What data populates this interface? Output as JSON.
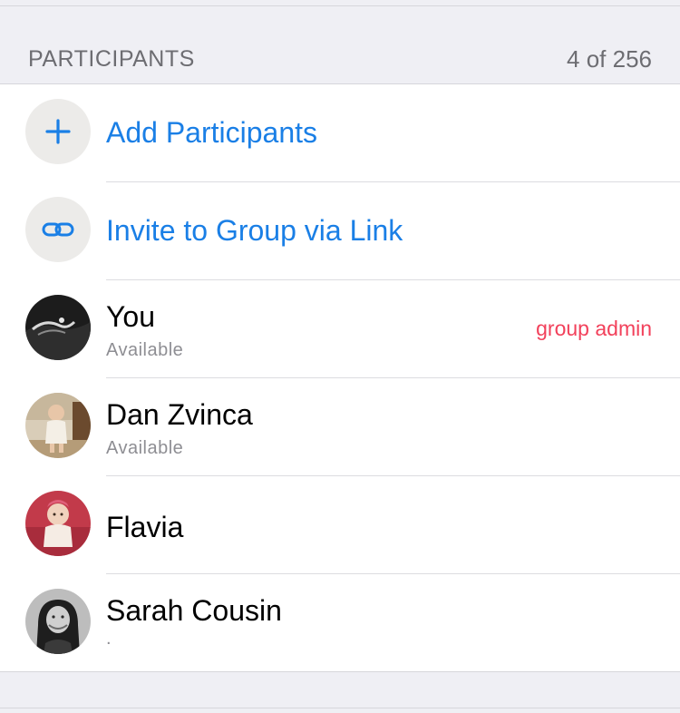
{
  "section": {
    "title": "PARTICIPANTS",
    "count": "4 of 256"
  },
  "actions": {
    "add_label": "Add Participants",
    "add_icon": "plus-icon",
    "invite_label": "Invite to Group via Link",
    "invite_icon": "link-icon"
  },
  "participants": [
    {
      "name": "You",
      "status": "Available",
      "badge": "group admin"
    },
    {
      "name": "Dan Zvinca",
      "status": "Available"
    },
    {
      "name": "Flavia",
      "status": ""
    },
    {
      "name": "Sarah Cousin",
      "status": "."
    }
  ],
  "colors": {
    "accent": "#1a7fe6",
    "admin": "#f2415b",
    "background": "#efeff4"
  }
}
